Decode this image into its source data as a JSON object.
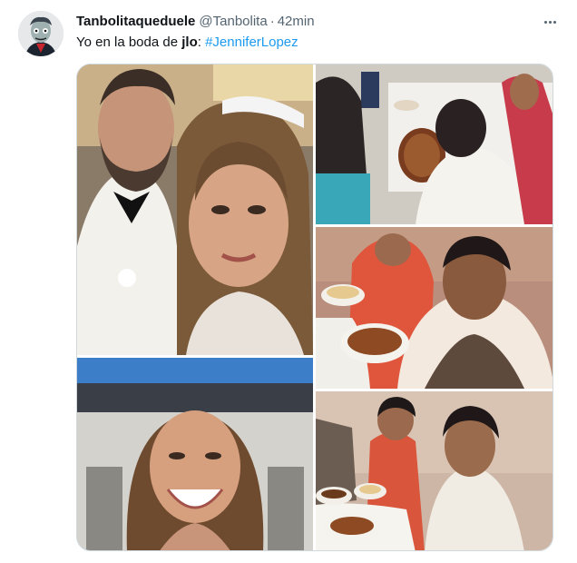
{
  "tweet": {
    "display_name": "Tanbolitaqueduele",
    "handle": "@Tanbolita",
    "separator": "·",
    "time": "42min",
    "text_prefix": "Yo en la boda de ",
    "text_bold": "jlo",
    "text_colon": ": ",
    "hashtag": "#JenniferLopez"
  },
  "icons": {
    "more": "more-horizontal-icon"
  },
  "colors": {
    "link": "#1d9bf0",
    "secondary_text": "#536471",
    "border": "#cfd9de"
  }
}
